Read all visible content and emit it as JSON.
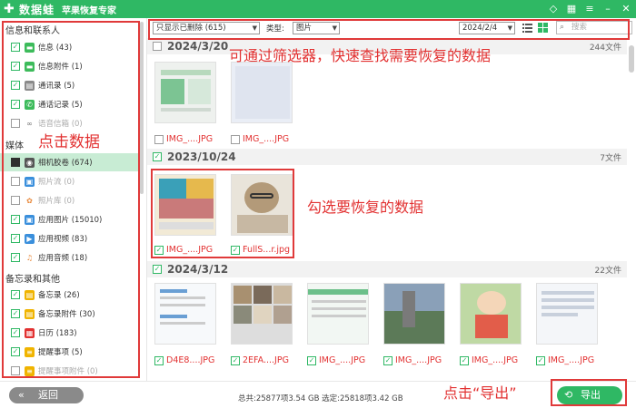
{
  "app": {
    "logo_text": "数据蛙",
    "title": "苹果恢复专家"
  },
  "sidebar": {
    "sections": [
      {
        "title": "信息和联系人",
        "items": [
          {
            "label": "信息 (43)",
            "checked": true,
            "icon": "message-icon",
            "color": "#3dbb5b"
          },
          {
            "label": "信息附件 (1)",
            "checked": true,
            "icon": "message-attachment-icon",
            "color": "#3dbb5b"
          },
          {
            "label": "通讯录 (5)",
            "checked": true,
            "icon": "contacts-icon",
            "color": "#8a8a8a"
          },
          {
            "label": "通话记录 (5)",
            "checked": true,
            "icon": "phone-icon",
            "color": "#3dbb5b"
          },
          {
            "label": "语音信箱 (0)",
            "checked": false,
            "icon": "voicemail-icon",
            "color": "#777"
          }
        ]
      },
      {
        "title": "媒体",
        "items": [
          {
            "label": "相机胶卷 (674)",
            "checked": true,
            "icon": "camera-icon",
            "color": "#555",
            "active": true
          },
          {
            "label": "照片流 (0)",
            "checked": false,
            "icon": "photo-stream-icon",
            "color": "#3a8fdc"
          },
          {
            "label": "照片库 (0)",
            "checked": false,
            "icon": "photo-library-icon",
            "color": "#e8883a"
          },
          {
            "label": "应用图片 (15010)",
            "checked": true,
            "icon": "app-image-icon",
            "color": "#3a8fdc"
          },
          {
            "label": "应用视频 (83)",
            "checked": true,
            "icon": "app-video-icon",
            "color": "#3a8fdc"
          },
          {
            "label": "应用音频 (18)",
            "checked": true,
            "icon": "app-audio-icon",
            "color": "#e8883a"
          }
        ]
      },
      {
        "title": "备忘录和其他",
        "items": [
          {
            "label": "备忘录 (26)",
            "checked": true,
            "icon": "notes-icon",
            "color": "#f0b400"
          },
          {
            "label": "备忘录附件 (30)",
            "checked": true,
            "icon": "notes-attachment-icon",
            "color": "#f0b400"
          },
          {
            "label": "日历 (183)",
            "checked": true,
            "icon": "calendar-icon",
            "color": "#e23131"
          },
          {
            "label": "提醒事项 (5)",
            "checked": true,
            "icon": "reminder-icon",
            "color": "#f0b400"
          },
          {
            "label": "提醒事项附件 (0)",
            "checked": false,
            "icon": "reminder-attachment-icon",
            "color": "#f0b400"
          }
        ]
      }
    ]
  },
  "toolbar": {
    "filter_value": "只显示已删除 (615)",
    "type_label": "类型:",
    "type_value": "图片",
    "date_value": "2024/2/4",
    "search_placeholder": "搜索"
  },
  "annotations": {
    "filter_tip": "可通过筛选器，快速查找需要恢复的数据",
    "click_data": "点击数据",
    "select_tip": "勾选要恢复的数据",
    "export_tip": "点击“导出”"
  },
  "groups": [
    {
      "date": "2024/3/20",
      "count": "244文件",
      "checked": false,
      "files": [
        "IMG_....JPG",
        "IMG_....JPG"
      ]
    },
    {
      "date": "2023/10/24",
      "count": "7文件",
      "checked": true,
      "files": [
        "IMG_....JPG",
        "FullS...r.jpg"
      ]
    },
    {
      "date": "2024/3/12",
      "count": "22文件",
      "checked": true,
      "files": [
        "D4E8....JPG",
        "2EFA....JPG",
        "IMG_....JPG",
        "IMG_....JPG",
        "IMG_....JPG",
        "IMG_....JPG"
      ]
    }
  ],
  "bottom": {
    "back_label": "返回",
    "status": "总共:25877项3.54 GB 选定:25818项3.42 GB",
    "export_label": "导出"
  },
  "colors": {
    "brand": "#2fb864",
    "annotation": "#e23131"
  }
}
